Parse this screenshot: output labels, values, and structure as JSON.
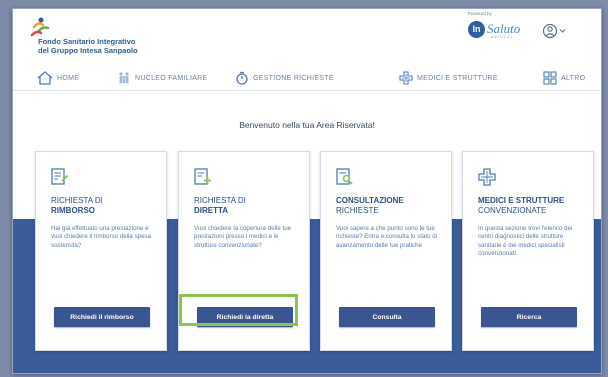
{
  "brand": {
    "line1": "Fondo Sanitario Integrativo",
    "line2": "del Gruppo Intesa Sanpaolo",
    "powered_by": "Powered by",
    "partner_mark": "In",
    "partner_name": "Saluto",
    "partner_sub": "MEDICAL"
  },
  "nav": {
    "home": "HOME",
    "family": "NUCLEO FAMILIARE",
    "requests": "GESTIONE RICHIESTE",
    "doctors": "MEDICI E STRUTTURE",
    "more": "ALTRO"
  },
  "welcome": "Benvenuto nella tua Area Riservata!",
  "cards": [
    {
      "title1": "RICHIESTA DI",
      "title2": "RIMBORSO",
      "desc": "Hai già effettuato una prestazione e vuoi chiedere il rimborso della spesa sostenuta?",
      "button": "Richiedi il rimborso"
    },
    {
      "title1": "RICHIESTA DI",
      "title2": "DIRETTA",
      "desc": "Vuoi chiedere la copertura delle tue prestazioni presso i medici e le strutture convenzionate?",
      "button": "Richiedi la diretta"
    },
    {
      "title1": "CONSULTAZIONE",
      "title2": "RICHIESTE",
      "desc": "Vuoi sapere a che punto sono le tue richieste? Entra e consulta lo stato di avanzamento delle tue pratiche",
      "button": "Consulta"
    },
    {
      "title1": "MEDICI E STRUTTURE",
      "title2": "CONVENZIONATE",
      "desc": "In questa sezione trovi l'elenco dei centri diagnostici delle strutture sanitarie e dei medici specialisti convenzionati.",
      "button": "Ricerca"
    }
  ],
  "colors": {
    "accent": "#3a5590",
    "band": "#3b5c9a",
    "highlight": "#8ac64f",
    "text_blue": "#2c4f85"
  },
  "icons": {
    "home": "home-icon",
    "family": "family-icon",
    "requests": "timer-icon",
    "doctors": "medical-cross-icon",
    "more": "grid-icon",
    "user": "user-icon"
  }
}
